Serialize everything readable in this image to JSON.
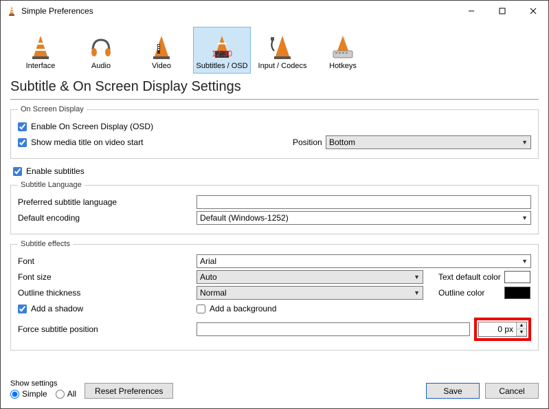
{
  "window": {
    "title": "Simple Preferences"
  },
  "tabs": [
    "Interface",
    "Audio",
    "Video",
    "Subtitles / OSD",
    "Input / Codecs",
    "Hotkeys"
  ],
  "heading": "Subtitle & On Screen Display Settings",
  "osd": {
    "legend": "On Screen Display",
    "enable_label": "Enable On Screen Display (OSD)",
    "enable_checked": true,
    "show_title_label": "Show media title on video start",
    "show_title_checked": true,
    "position_label": "Position",
    "position_value": "Bottom"
  },
  "enable_subtitles": {
    "label": "Enable subtitles",
    "checked": true
  },
  "lang": {
    "legend": "Subtitle Language",
    "pref_label": "Preferred subtitle language",
    "pref_value": "",
    "enc_label": "Default encoding",
    "enc_value": "Default (Windows-1252)"
  },
  "effects": {
    "legend": "Subtitle effects",
    "font_label": "Font",
    "font_value": "Arial",
    "size_label": "Font size",
    "size_value": "Auto",
    "textcolor_label": "Text default color",
    "textcolor": "#ffffff",
    "outline_label": "Outline thickness",
    "outline_value": "Normal",
    "outlinecolor_label": "Outline color",
    "outlinecolor": "#000000",
    "shadow_label": "Add a shadow",
    "shadow_checked": true,
    "bg_label": "Add a background",
    "bg_checked": false,
    "force_label": "Force subtitle position",
    "force_value": "0 px"
  },
  "footer": {
    "show_settings": "Show settings",
    "simple": "Simple",
    "all": "All",
    "reset": "Reset Preferences",
    "save": "Save",
    "cancel": "Cancel"
  }
}
